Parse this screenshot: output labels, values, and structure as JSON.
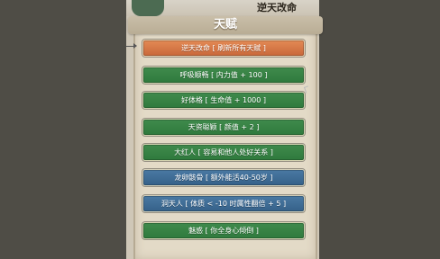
{
  "header": {
    "title": "逆天改命"
  },
  "panel": {
    "title": "天赋"
  },
  "talents": [
    {
      "label": "逆天改命 [ 刷新所有天赋 ]",
      "color": "#d97a48"
    },
    {
      "label": "呼吸顺畅 [ 内力值 + 100 ]",
      "color": "#3a8447"
    },
    {
      "label": "好体格 [ 生命值 + 1000 ]",
      "color": "#3a8447"
    },
    {
      "label": "天资聪颖 [ 颜值 + 2 ]",
      "color": "#3a8447"
    },
    {
      "label": "大红人 [ 容易和他人处好关系 ]",
      "color": "#3a8447"
    },
    {
      "label": "龙卵骸骨 [ 额外能活40-50岁 ]",
      "color": "#3f6f98"
    },
    {
      "label": "洞天人 [ 体质 < -10 时属性翻倍 + 5 ]",
      "color": "#3f6f98"
    },
    {
      "label": "魅惑 [ 你全身心倾倒 ]",
      "color": "#3a8447"
    }
  ]
}
